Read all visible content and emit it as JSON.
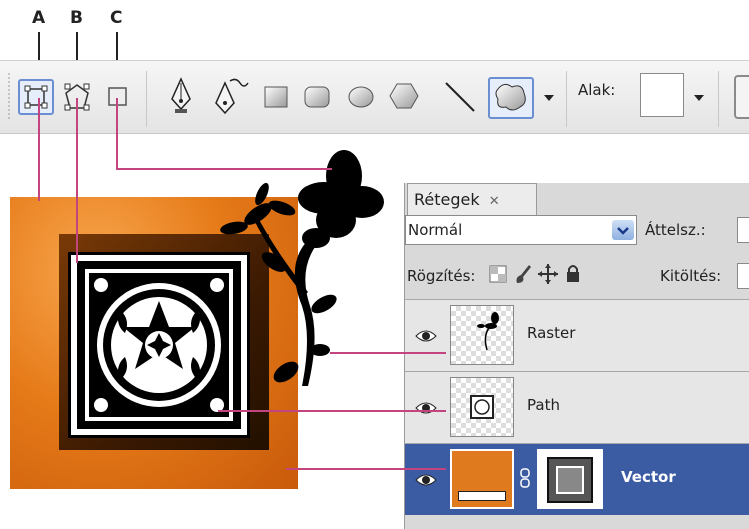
{
  "callouts": {
    "a": "A",
    "b": "B",
    "c": "C"
  },
  "toolbar": {
    "shape_label": "Alak:",
    "tools": [
      "shape-layers-icon",
      "paths-icon",
      "fill-pixels-icon",
      "pen-icon",
      "freeform-pen-icon",
      "rectangle-icon",
      "rounded-rectangle-icon",
      "ellipse-icon",
      "polygon-icon",
      "line-icon",
      "custom-shape-icon"
    ]
  },
  "layers_panel": {
    "tab_label": "Rétegek",
    "blend_mode": "Normál",
    "opacity_label": "Áttelsz.:",
    "lock_label": "Rögzítés:",
    "fill_label": "Kitöltés:",
    "layers": [
      {
        "name": "Raster",
        "selected": false
      },
      {
        "name": "Path",
        "selected": false
      },
      {
        "name": "Vector",
        "selected": true
      }
    ]
  },
  "colors": {
    "orange": "#e07a1f",
    "selection": "#3a5aa0",
    "callout_line": "#c2457f"
  }
}
